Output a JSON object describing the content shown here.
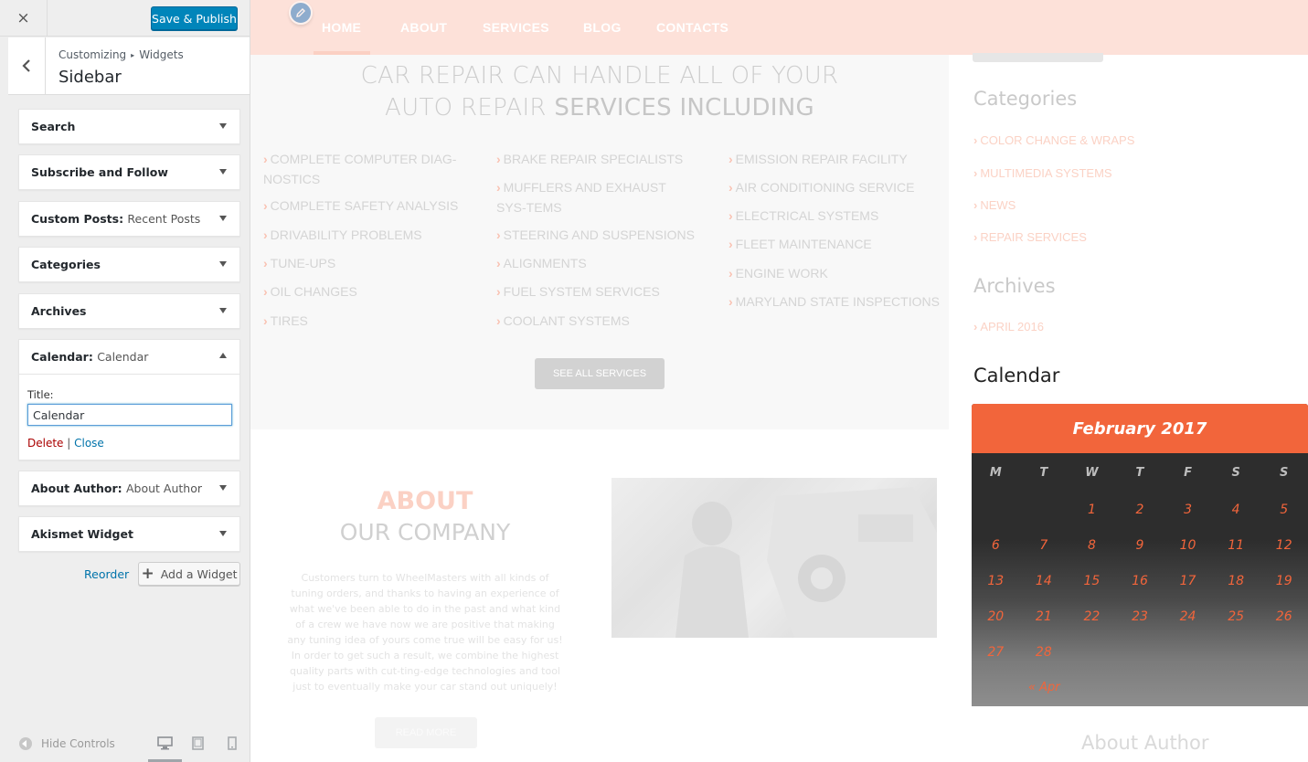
{
  "customizer": {
    "close_label": "×",
    "save_label": "Save & Publish",
    "breadcrumb": {
      "root": "Customizing",
      "separator": "▸",
      "parent": "Widgets"
    },
    "section_title": "Sidebar",
    "widgets": [
      {
        "title": "Search",
        "in": ""
      },
      {
        "title": "Subscribe and Follow",
        "in": ""
      },
      {
        "title": "Custom Posts",
        "in": "Recent Posts"
      },
      {
        "title": "Categories",
        "in": ""
      },
      {
        "title": "Archives",
        "in": ""
      },
      {
        "title": "Calendar",
        "in": "Calendar"
      },
      {
        "title": "About Author",
        "in": "About Author"
      },
      {
        "title": "Akismet Widget",
        "in": ""
      }
    ],
    "title_sep": ": ",
    "calendar_form": {
      "title_label": "Title:",
      "title_value": "Calendar",
      "delete_label": "Delete",
      "action_sep": " | ",
      "close_label": "Close"
    },
    "reorder_label": "Reorder",
    "add_widget_label": "Add a Widget",
    "hide_controls_label": "Hide Controls"
  },
  "preview": {
    "nav": [
      "HOME",
      "ABOUT",
      "SERVICES",
      "BLOG",
      "CONTACTS"
    ],
    "services_heading_line1": "CAR REPAIR CAN HANDLE ALL OF YOUR",
    "services_heading_line2_light": "AUTO REPAIR ",
    "services_heading_line2_bold": "SERVICES INCLUDING",
    "services_col1": [
      "COMPLETE COMPUTER DIAG-NOSTICS",
      "COMPLETE SAFETY ANALYSIS",
      "DRIVABILITY PROBLEMS",
      "TUNE-UPS",
      "OIL CHANGES",
      "TIRES"
    ],
    "services_col2": [
      "BRAKE REPAIR SPECIALISTS",
      "MUFFLERS AND EXHAUST SYS-TEMS",
      "STEERING AND SUSPENSIONS",
      "ALIGNMENTS",
      "FUEL SYSTEM SERVICES",
      "COOLANT SYSTEMS"
    ],
    "services_col3": [
      "EMISSION REPAIR FACILITY",
      "AIR CONDITIONING SERVICE",
      "ELECTRICAL SYSTEMS",
      "FLEET MAINTENANCE",
      "ENGINE WORK",
      "MARYLAND STATE INSPECTIONS"
    ],
    "see_all_label": "SEE ALL SERVICES",
    "about_title": "ABOUT",
    "about_subtitle": "OUR COMPANY",
    "about_text": "Customers turn to WheelMasters with all kinds of tuning orders, and thanks to having an experience of what we've been able to do in the past and what kind of a crew we have now we are positive that making any tuning idea of yours come true will be easy for us! In order to get such a result, we combine the highest quality parts with cut-ting-edge technologies and tool just to eventually make your car stand out uniquely!",
    "read_more_label": "READ MORE",
    "categories_heading": "Categories",
    "categories": [
      "COLOR CHANGE & WRAPS",
      "MULTIMEDIA SYSTEMS",
      "NEWS",
      "REPAIR SERVICES"
    ],
    "archives_heading": "Archives",
    "archives": [
      "APRIL 2016"
    ],
    "calendar_heading": "Calendar",
    "calendar": {
      "month": "February 2017",
      "weekdays": [
        "M",
        "T",
        "W",
        "T",
        "F",
        "S",
        "S"
      ],
      "weeks": [
        [
          "",
          "",
          "1",
          "2",
          "3",
          "4",
          "5"
        ],
        [
          "6",
          "7",
          "8",
          "9",
          "10",
          "11",
          "12"
        ],
        [
          "13",
          "14",
          "15",
          "16",
          "17",
          "18",
          "19"
        ],
        [
          "20",
          "21",
          "22",
          "23",
          "24",
          "25",
          "26"
        ],
        [
          "27",
          "28",
          "",
          "",
          "",
          "",
          ""
        ]
      ],
      "prev_label": "« Apr"
    },
    "about_author_heading": "About Author"
  },
  "colors": {
    "accent": "#f2653b",
    "primary_button": "#0085ba",
    "link": "#0073aa",
    "delete": "#aa0000",
    "nav_bg": "#fde1d9"
  },
  "icons": [
    "close-icon",
    "chevron-left-icon",
    "dropdown-arrow-icon",
    "plus-icon",
    "hide-controls-icon",
    "desktop-icon",
    "tablet-icon",
    "mobile-icon",
    "pencil-edit-icon",
    "chevron-right-icon"
  ]
}
